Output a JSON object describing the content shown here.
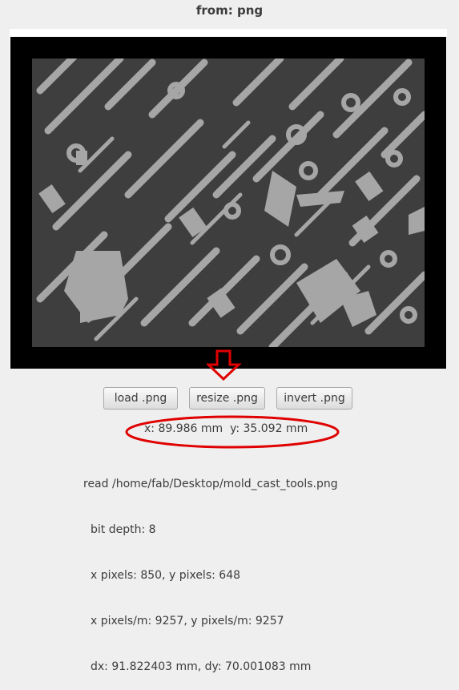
{
  "window": {
    "title": "from: png"
  },
  "buttons": {
    "load": "load .png",
    "resize": "resize .png",
    "invert": "invert .png"
  },
  "position": {
    "readout": "x: 89.986 mm  y: 35.092 mm"
  },
  "info": {
    "read": "read /home/fab/Desktop/mold_cast_tools.png",
    "bit_depth": "bit depth: 8",
    "pixels": "x pixels: 850, y pixels: 648",
    "pixels_per_m": "x pixels/m: 9257, y pixels/m: 9257",
    "size": "dx: 91.822403 mm, dy: 70.001083 mm"
  },
  "colors": {
    "annotation": "#e00000",
    "image_bg": "#3e3e3e",
    "tool_fill": "#a6a6a6"
  },
  "icons": {
    "annotation_arrow": "down-arrow-icon"
  }
}
